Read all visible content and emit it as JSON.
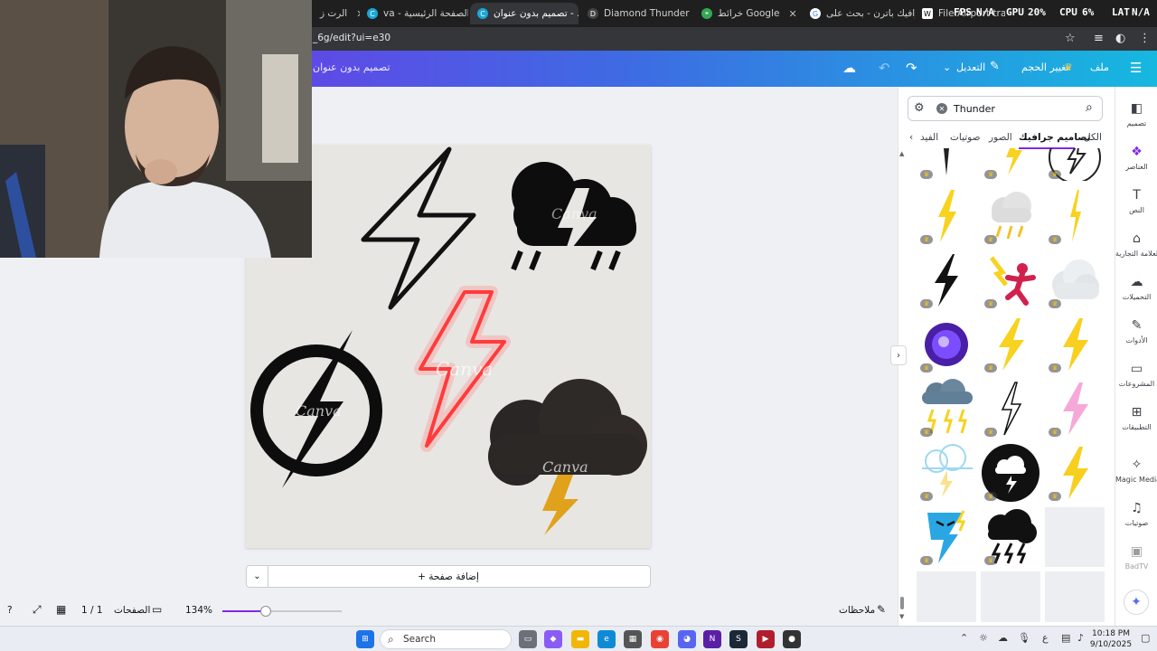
{
  "browser": {
    "tabs": [
      {
        "label": "الرت ز",
        "x": 0
      },
      {
        "label": "va - الصفحة الرئيسية",
        "x": 0
      },
      {
        "label": "تصميم بدون عنوان - ...",
        "x": 0
      },
      {
        "label": "Diamond Thunder Lo",
        "x": 0
      },
      {
        "label": "خرائط Google",
        "x": 0
      },
      {
        "label": "ترافيك باترن - بحث على",
        "x": 0
      },
      {
        "label": "File:Airport traffic p",
        "x": 0
      }
    ],
    "url": "_6g/edit?ui=e30",
    "perf": {
      "fps_label": "FPS",
      "fps_value": "N/A",
      "gpu_label": "GPU",
      "gpu_value": "20%",
      "cpu_label": "CPU",
      "cpu_value": "6%",
      "lat_label": "LAT",
      "lat_value": "N/A"
    }
  },
  "canva_header": {
    "file": "ملف",
    "resize": "تغيير الحجم",
    "edit": "التعديل",
    "doc_title": "تصميم بدون عنوان"
  },
  "canvas": {
    "add_page": "+ إضافة صفحة",
    "watermark": "Canva"
  },
  "bottom_bar": {
    "notes": "ملاحظات",
    "zoom": "134%",
    "zoom_fraction": 0.36,
    "pages_label": "الصفحات",
    "page_count": "1 / 1"
  },
  "panel": {
    "search_value": "Thunder",
    "tabs": [
      "الكل",
      "تصاميم جرافيك",
      "الصور",
      "صوتيات",
      "الفيد"
    ],
    "active_tab": "تصاميم جرافيك"
  },
  "rail": {
    "items": [
      "تصميم",
      "العناصر",
      "النص",
      "العلامة التجارية",
      "التحميلات",
      "الأدوات",
      "المشروعات",
      "التطبيقات",
      "Magic Media",
      "صوتيات",
      "BadTV"
    ]
  },
  "taskbar": {
    "search": "Search",
    "lang": "ع",
    "time": "10:18 PM",
    "date": "9/10/2025"
  },
  "colors": {
    "canva_purple": "#7d2ae8",
    "canva_blue": "#16b8e0",
    "bolt_yellow": "#f7d21f",
    "neon_red": "#ff4d4d"
  }
}
